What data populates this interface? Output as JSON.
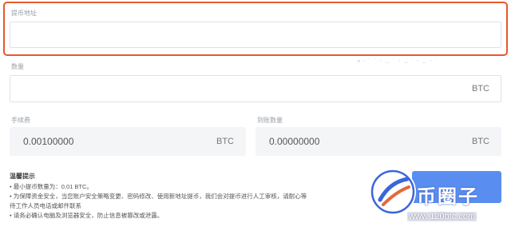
{
  "address": {
    "label": "提币地址",
    "value": ""
  },
  "amount": {
    "label": "数量",
    "value": "",
    "unit": "BTC"
  },
  "available": {
    "text": "• ‧ ˙ ˙ ‧ ‥ ˙ ‧ ‥ ˙ ‧ ‥ ‧ ˙"
  },
  "fee": {
    "label": "手续费",
    "value": "0.00100000",
    "unit": "BTC"
  },
  "received": {
    "label": "到账数量",
    "value": "0.00000000",
    "unit": "BTC"
  },
  "tips": {
    "title": "温馨提示",
    "items": [
      "• 最小提币数量为：0.01 BTC。",
      "• 为保障资金安全，当您账户安全策略变更、密码修改、使用新地址提币，我们会对提币进行人工审核，请耐心等",
      "待工作人员电话或邮件联系",
      "• 请务必确认电脑及浏览器安全，防止信息被篡改或泄露。"
    ]
  },
  "submit": {
    "label": ""
  },
  "watermark": {
    "brand": "币圈子",
    "url": "www.120btc.com"
  },
  "colors": {
    "highlight": "#e8582e",
    "accent": "#5a8df0"
  }
}
